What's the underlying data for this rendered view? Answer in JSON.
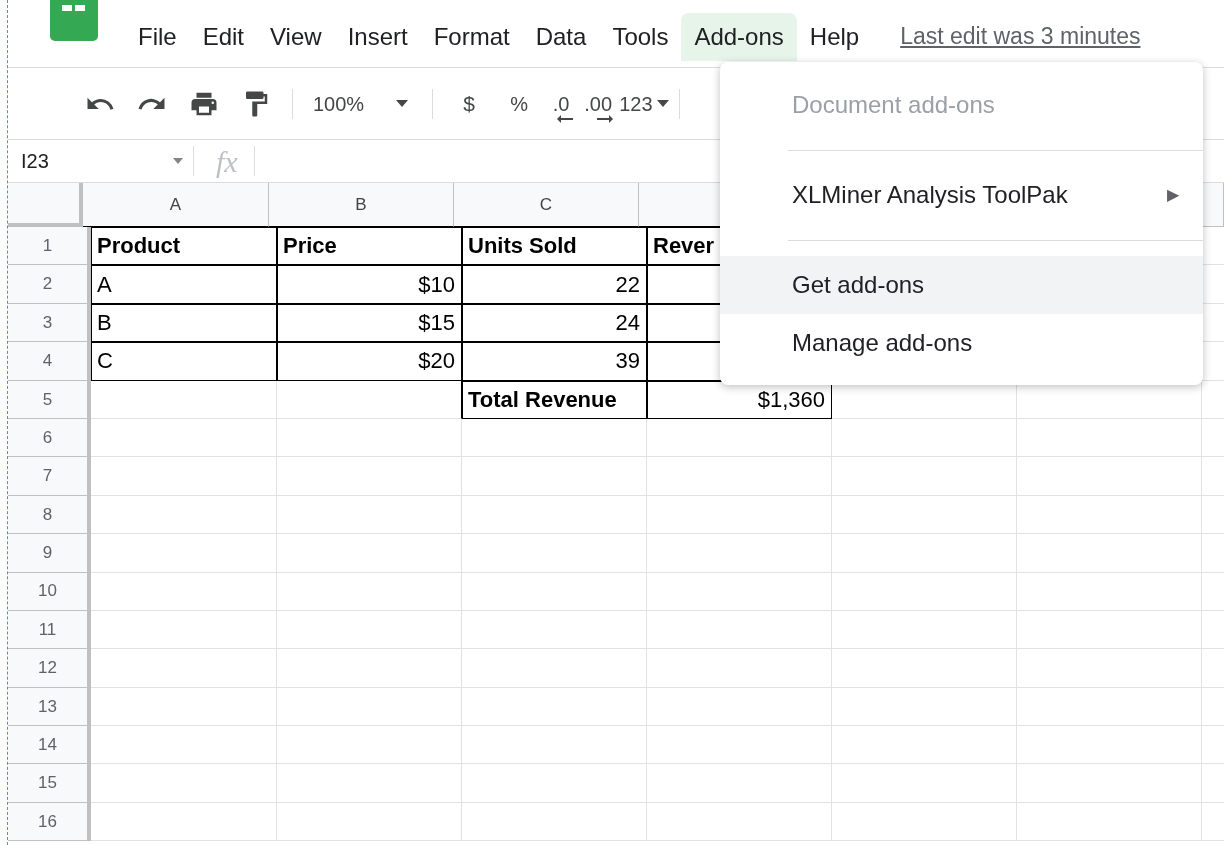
{
  "menu_bar": {
    "items": [
      {
        "label": "File",
        "selected": false
      },
      {
        "label": "Edit",
        "selected": false
      },
      {
        "label": "View",
        "selected": false
      },
      {
        "label": "Insert",
        "selected": false
      },
      {
        "label": "Format",
        "selected": false
      },
      {
        "label": "Data",
        "selected": false
      },
      {
        "label": "Tools",
        "selected": false
      },
      {
        "label": "Add-ons",
        "selected": true
      },
      {
        "label": "Help",
        "selected": false
      }
    ],
    "last_edit": "Last edit was 3 minutes"
  },
  "toolbar": {
    "zoom": "100%",
    "currency": "$",
    "percent": "%",
    "decrease_decimals": ".0",
    "increase_decimals": ".00",
    "number_format": "123"
  },
  "formula_bar": {
    "cell_reference": "I23",
    "fx": "fx"
  },
  "sheet": {
    "columns": [
      "A",
      "B",
      "C"
    ],
    "rows": [
      {
        "number": "1",
        "cells": [
          {
            "text": "Product",
            "bold": true,
            "right_aligned": false,
            "bordered": true
          },
          {
            "text": "Price",
            "bold": true,
            "right_aligned": false,
            "bordered": true
          },
          {
            "text": "Units Sold",
            "bold": true,
            "right_aligned": false,
            "bordered": true
          },
          {
            "text": "Rever",
            "bold": true,
            "right_aligned": false,
            "bordered": true
          }
        ]
      },
      {
        "number": "2",
        "cells": [
          {
            "text": "A",
            "bold": false,
            "right_aligned": false,
            "bordered": true
          },
          {
            "text": "$10",
            "bold": false,
            "right_aligned": true,
            "bordered": true
          },
          {
            "text": "22",
            "bold": false,
            "right_aligned": true,
            "bordered": true
          },
          {
            "bordered": true
          }
        ]
      },
      {
        "number": "3",
        "cells": [
          {
            "text": "B",
            "bold": false,
            "right_aligned": false,
            "bordered": true
          },
          {
            "text": "$15",
            "bold": false,
            "right_aligned": true,
            "bordered": true
          },
          {
            "text": "24",
            "bold": false,
            "right_aligned": true,
            "bordered": true
          },
          {
            "bordered": true
          }
        ]
      },
      {
        "number": "4",
        "cells": [
          {
            "text": "C",
            "bold": false,
            "right_aligned": false,
            "bordered": true
          },
          {
            "text": "$20",
            "bold": false,
            "right_aligned": true,
            "bordered": true
          },
          {
            "text": "39",
            "bold": false,
            "right_aligned": true,
            "bordered": true
          },
          {
            "bordered": true
          }
        ]
      },
      {
        "number": "5",
        "cells": [
          {
            "bordered": false
          },
          {
            "bordered": false
          },
          {
            "text": "Total Revenue",
            "bold": true,
            "right_aligned": false,
            "bordered": true
          },
          {
            "text": "$1,360",
            "bold": false,
            "right_aligned": true,
            "bordered": true
          }
        ]
      },
      {
        "number": "6"
      },
      {
        "number": "7"
      },
      {
        "number": "8"
      },
      {
        "number": "9"
      },
      {
        "number": "10"
      },
      {
        "number": "11"
      },
      {
        "number": "12"
      },
      {
        "number": "13"
      },
      {
        "number": "14"
      },
      {
        "number": "15"
      },
      {
        "number": "16"
      }
    ]
  },
  "dropdown_menu": {
    "items": [
      {
        "kind": "item",
        "label": "Document add-ons",
        "disabled": true,
        "selected": false
      },
      {
        "kind": "separator"
      },
      {
        "kind": "item",
        "label": "XLMiner Analysis ToolPak",
        "disabled": false,
        "selected": false,
        "submenu_arrow": "▶"
      },
      {
        "kind": "separator"
      },
      {
        "kind": "item",
        "label": "Get add-ons",
        "disabled": false,
        "selected": true
      },
      {
        "kind": "item",
        "label": "Manage add-ons",
        "disabled": false,
        "selected": false
      }
    ]
  }
}
